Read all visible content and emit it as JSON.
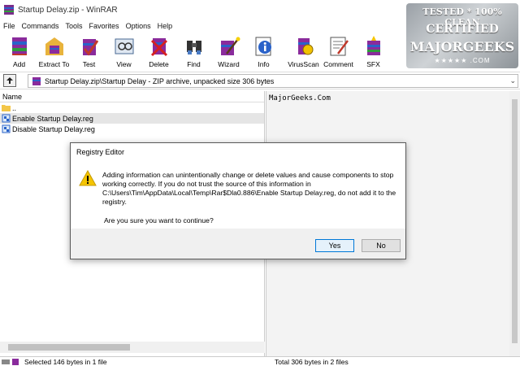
{
  "window": {
    "title": "Startup Delay.zip - WinRAR"
  },
  "menu": [
    "File",
    "Commands",
    "Tools",
    "Favorites",
    "Options",
    "Help"
  ],
  "toolbar": [
    {
      "label": "Add",
      "icon": "add-archive-icon"
    },
    {
      "label": "Extract To",
      "icon": "extract-icon"
    },
    {
      "label": "Test",
      "icon": "test-icon"
    },
    {
      "label": "View",
      "icon": "view-icon"
    },
    {
      "label": "Delete",
      "icon": "delete-icon"
    },
    {
      "label": "Find",
      "icon": "find-icon"
    },
    {
      "label": "Wizard",
      "icon": "wizard-icon"
    },
    {
      "label": "Info",
      "icon": "info-icon"
    },
    {
      "label": "VirusScan",
      "icon": "virusscan-icon"
    },
    {
      "label": "Comment",
      "icon": "comment-icon"
    },
    {
      "label": "SFX",
      "icon": "sfx-icon"
    }
  ],
  "badge": {
    "line1": "TESTED * 100% CLEAN",
    "line2": "CERTIFIED",
    "line3": "MAJORGEEKS",
    "line4": "★★★★★ .COM"
  },
  "address": {
    "text": "Startup Delay.zip\\Startup Delay - ZIP archive, unpacked size 306 bytes"
  },
  "filelist": {
    "header": "Name",
    "rows": [
      {
        "name": "..",
        "icon": "folder-icon"
      },
      {
        "name": "Enable Startup Delay.reg",
        "icon": "reg-file-icon"
      },
      {
        "name": "Disable Startup Delay.reg",
        "icon": "reg-file-icon"
      }
    ]
  },
  "viewer": {
    "text": "MajorGeeks.Com"
  },
  "status": {
    "left": "Selected 146 bytes in 1 file",
    "right": "Total 306 bytes in 2 files"
  },
  "dialog": {
    "title": "Registry Editor",
    "message": "Adding information can unintentionally change or delete values and cause components to stop working correctly. If you do not trust the source of this information in C:\\Users\\Tim\\AppData\\Local\\Temp\\Rar$Dla0.886\\Enable Startup Delay.reg, do not add it to the registry.",
    "question": "Are you sure you want to continue?",
    "yes": "Yes",
    "no": "No"
  },
  "colors": {
    "accent": "#0078d7",
    "warning": "#f5c400"
  }
}
